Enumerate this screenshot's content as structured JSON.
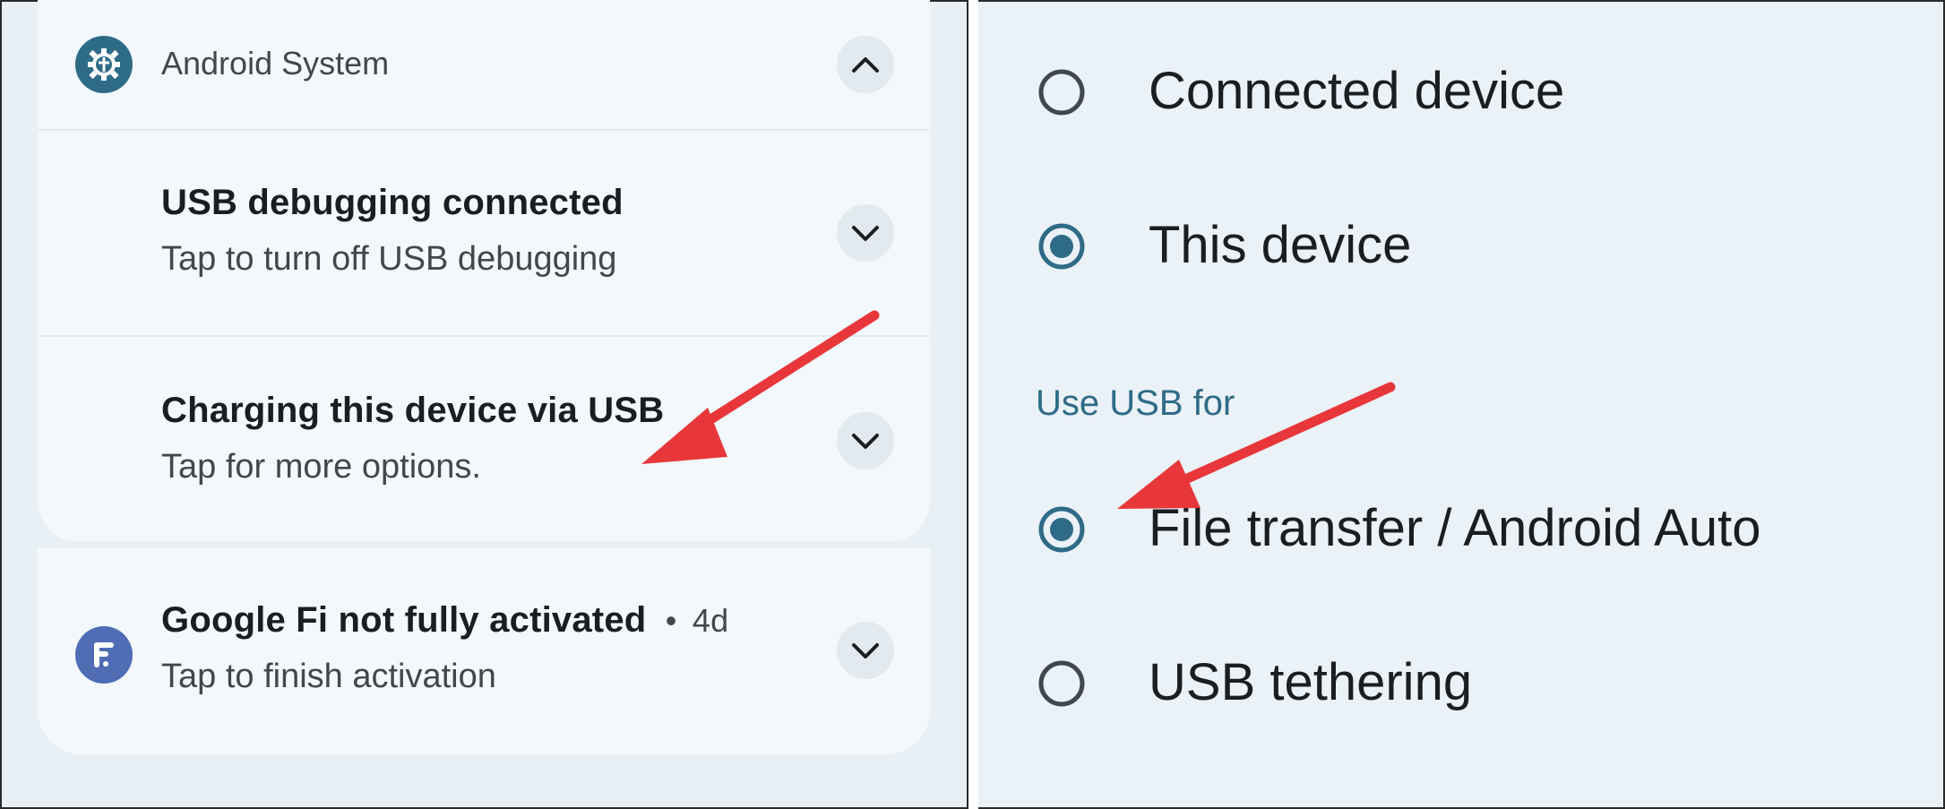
{
  "notifications": {
    "group": {
      "app_name": "Android System",
      "app_icon": "gear-icon",
      "collapse_icon": "chevron-up-icon",
      "items": [
        {
          "title": "USB debugging connected",
          "subtitle": "Tap to turn off USB debugging",
          "expand_icon": "chevron-down-icon"
        },
        {
          "title": "Charging this device via USB",
          "subtitle": "Tap for more options.",
          "expand_icon": "chevron-down-icon"
        }
      ]
    },
    "fi": {
      "title": "Google Fi not fully activated",
      "separator": "•",
      "time": "4d",
      "subtitle": "Tap to finish activation",
      "app_icon": "google-fi-icon",
      "expand_icon": "chevron-down-icon"
    }
  },
  "usb_settings": {
    "controlled_by": [
      {
        "label": "Connected device",
        "selected": false
      },
      {
        "label": "This device",
        "selected": true
      }
    ],
    "section_label": "Use USB for",
    "use_usb_for": [
      {
        "label": "File transfer / Android Auto",
        "selected": true
      },
      {
        "label": "USB tethering",
        "selected": false
      }
    ]
  },
  "colors": {
    "accent": "#2e6b86",
    "annotation_arrow": "#e8373a",
    "card_bg": "#f2f8fb",
    "panel_bg": "#e8f0f6"
  }
}
